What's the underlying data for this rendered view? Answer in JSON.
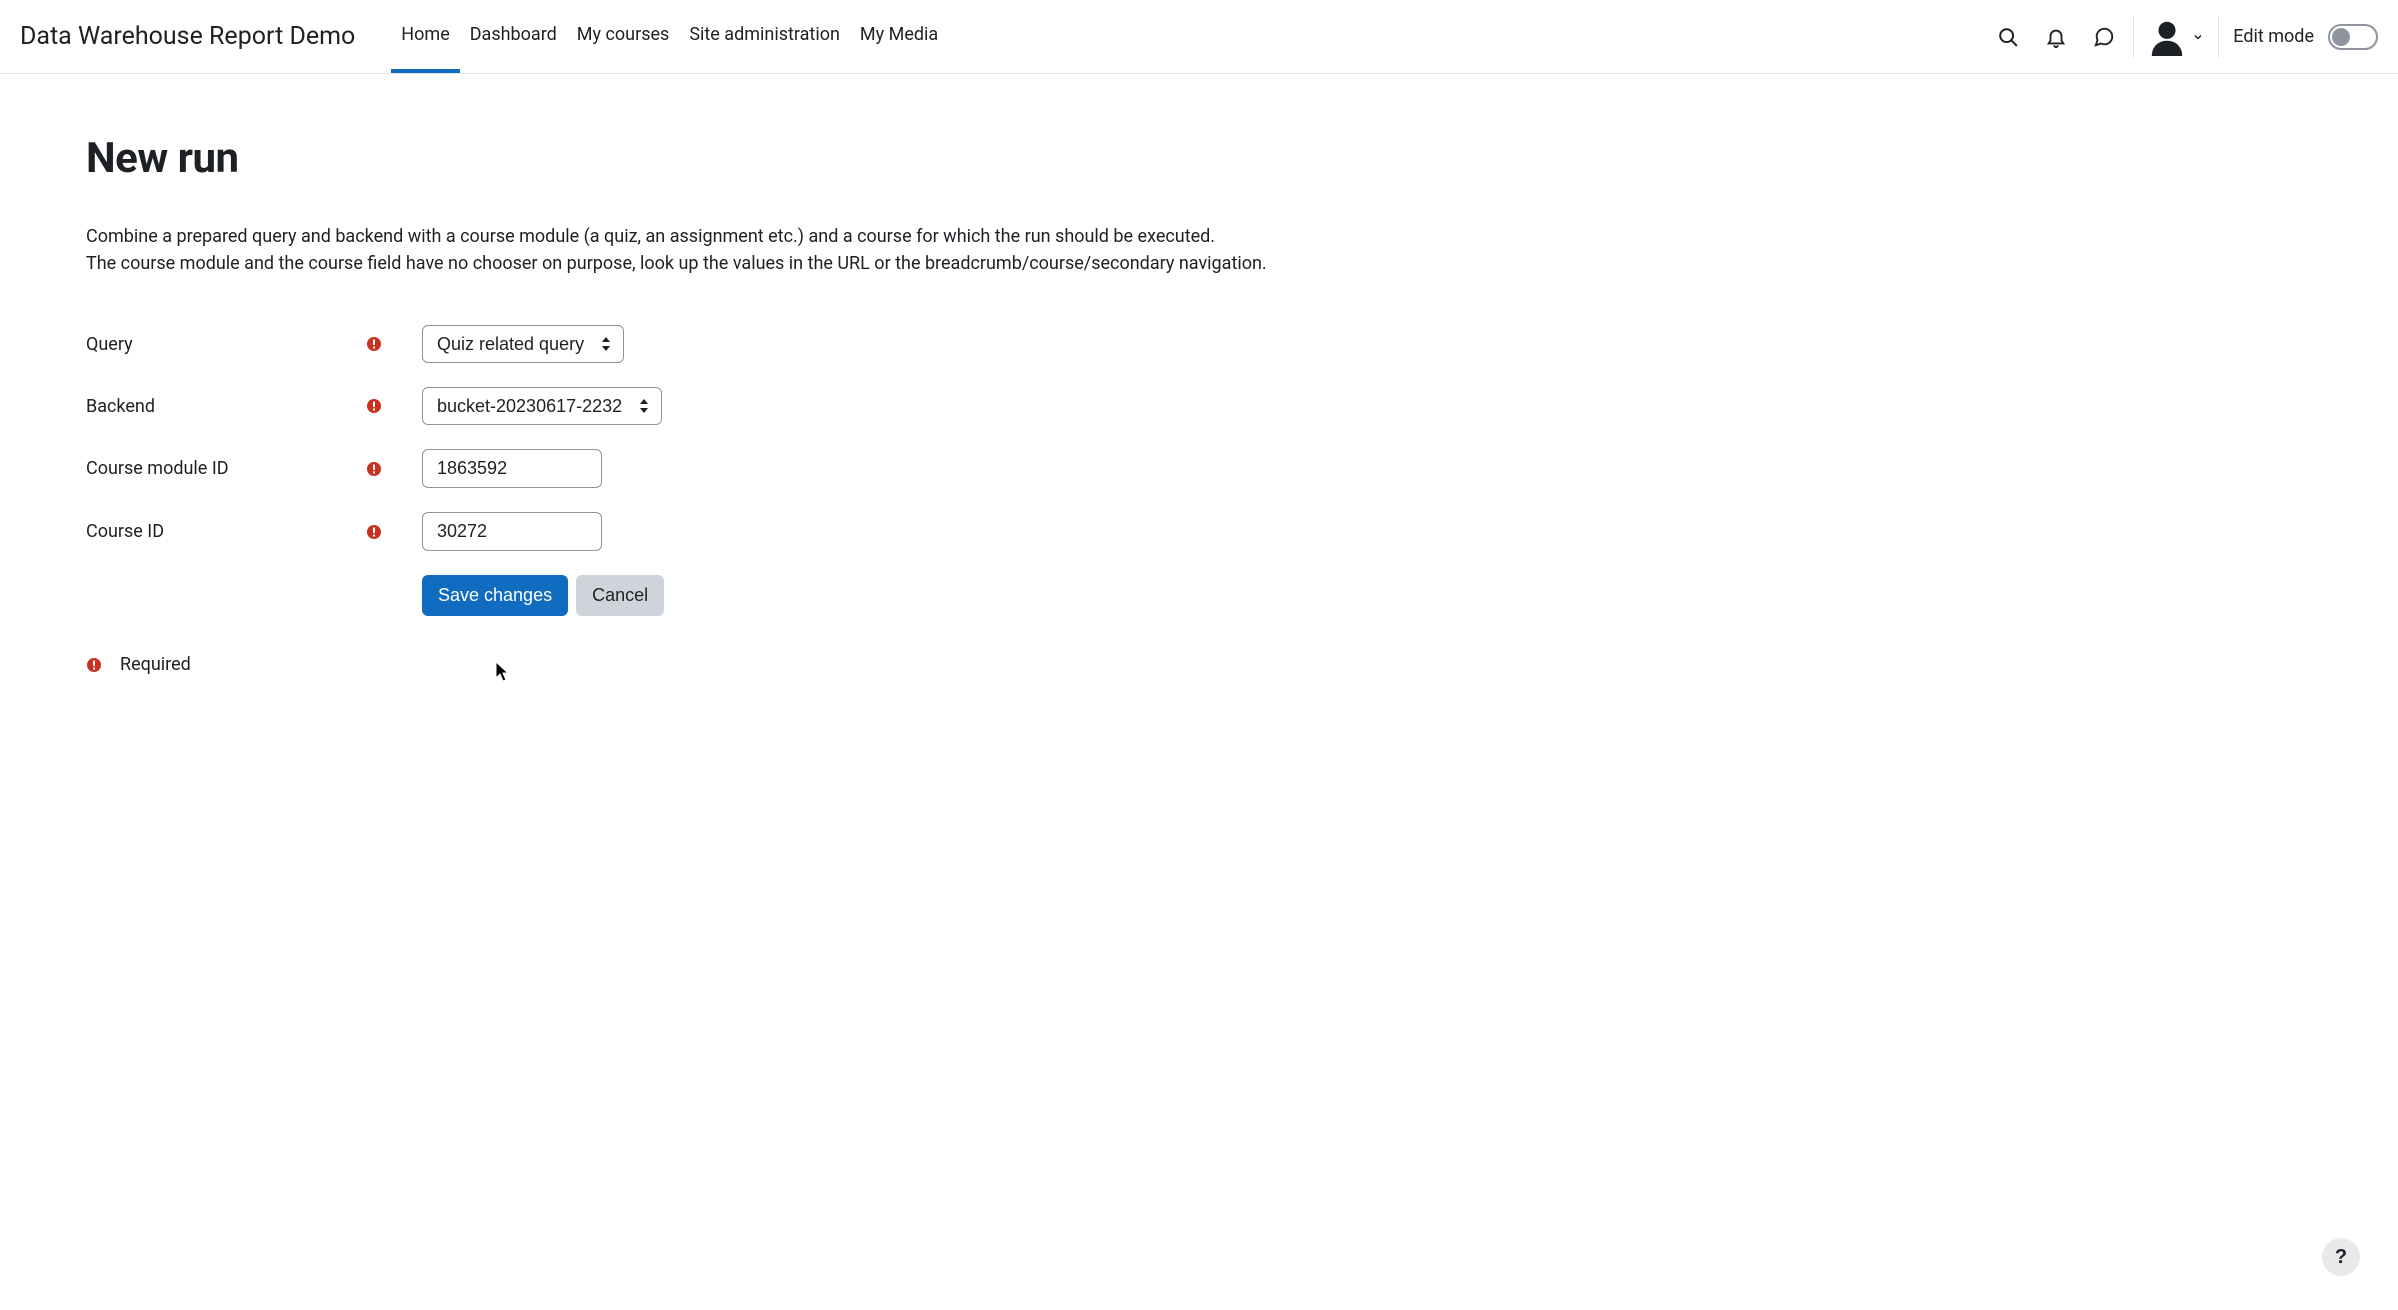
{
  "brand": "Data Warehouse Report Demo",
  "nav": {
    "home": "Home",
    "dashboard": "Dashboard",
    "my_courses": "My courses",
    "site_admin": "Site administration",
    "my_media": "My Media"
  },
  "header": {
    "edit_mode_label": "Edit mode"
  },
  "page": {
    "title": "New run",
    "desc_line1": "Combine a prepared query and backend with a course module (a quiz, an assignment etc.) and a course for which the run should be executed.",
    "desc_line2": "The course module and the course field have no chooser on purpose, look up the values in the URL or the breadcrumb/course/secondary navigation."
  },
  "form": {
    "query": {
      "label": "Query",
      "value": "Quiz related query"
    },
    "backend": {
      "label": "Backend",
      "value": "bucket-20230617-2232"
    },
    "cmid": {
      "label": "Course module ID",
      "value": "1863592"
    },
    "courseid": {
      "label": "Course ID",
      "value": "30272"
    },
    "save_label": "Save changes",
    "cancel_label": "Cancel",
    "required_legend": "Required"
  },
  "help_fab": "?"
}
